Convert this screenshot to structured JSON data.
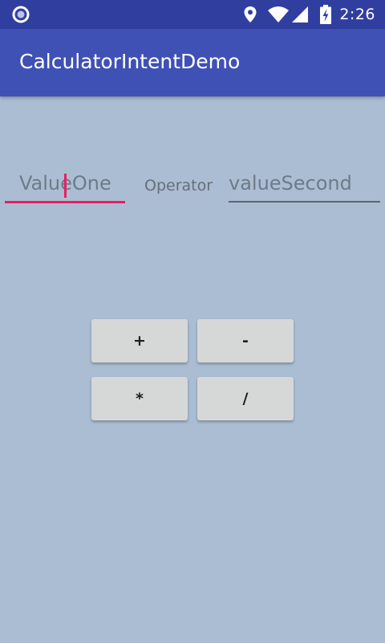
{
  "status_bar": {
    "time": "2:26",
    "icons": [
      "notification-circle-icon",
      "location-icon",
      "wifi-icon",
      "signal-icon",
      "battery-charging-icon"
    ]
  },
  "app_bar": {
    "title": "CalculatorIntentDemo"
  },
  "form": {
    "value_one": {
      "text": "ValueOne",
      "focused": true
    },
    "operator_label": "Operator",
    "value_second": {
      "text": "valueSecond",
      "focused": false
    }
  },
  "operations": {
    "add": "+",
    "subtract": "-",
    "multiply": "*",
    "divide": "/"
  },
  "colors": {
    "status_bar": "#303f9f",
    "app_bar": "#3f51b5",
    "background": "#aabdd3",
    "accent": "#e91e63",
    "button": "#d6d7d7"
  }
}
